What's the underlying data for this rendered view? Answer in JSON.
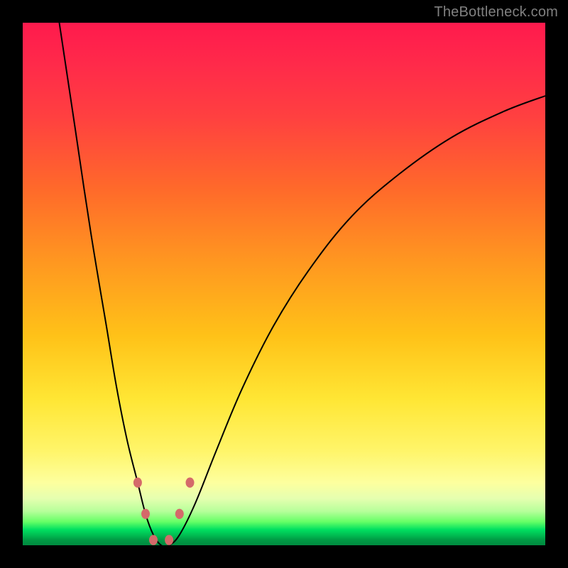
{
  "watermark": "TheBottleneck.com",
  "chart_data": {
    "type": "line",
    "title": "",
    "xlabel": "",
    "ylabel": "",
    "xlim": [
      0,
      100
    ],
    "ylim": [
      0,
      100
    ],
    "grid": false,
    "legend": false,
    "background_gradient": {
      "direction": "vertical",
      "stops": [
        {
          "pos": 0,
          "color": "#ff1a4d"
        },
        {
          "pos": 18,
          "color": "#ff4040"
        },
        {
          "pos": 46,
          "color": "#ff9820"
        },
        {
          "pos": 72,
          "color": "#ffe634"
        },
        {
          "pos": 91,
          "color": "#e6ffb0"
        },
        {
          "pos": 97,
          "color": "#00e060"
        },
        {
          "pos": 100,
          "color": "#008a40"
        }
      ]
    },
    "series": [
      {
        "name": "bottleneck-curve",
        "color": "#000000",
        "x": [
          7,
          10,
          13,
          16,
          18,
          20,
          22,
          23.5,
          25,
          26.5,
          28,
          30,
          33,
          37,
          42,
          48,
          55,
          63,
          72,
          82,
          92,
          100
        ],
        "y": [
          100,
          80,
          60,
          42,
          30,
          20,
          12,
          6,
          2,
          0,
          0,
          2,
          8,
          18,
          30,
          42,
          53,
          63,
          71,
          78,
          83,
          86
        ]
      }
    ],
    "markers": [
      {
        "name": "knee-left-upper",
        "x": 22,
        "y": 12,
        "color": "#d46a6a",
        "size": 12
      },
      {
        "name": "knee-left-lower",
        "x": 23.5,
        "y": 6,
        "color": "#d46a6a",
        "size": 12
      },
      {
        "name": "trough-left",
        "x": 25,
        "y": 1,
        "color": "#d46a6a",
        "size": 12
      },
      {
        "name": "trough-right",
        "x": 28,
        "y": 1,
        "color": "#d46a6a",
        "size": 12
      },
      {
        "name": "knee-right-lower",
        "x": 30,
        "y": 6,
        "color": "#d46a6a",
        "size": 12
      },
      {
        "name": "knee-right-upper",
        "x": 32,
        "y": 12,
        "color": "#d46a6a",
        "size": 12
      }
    ]
  }
}
